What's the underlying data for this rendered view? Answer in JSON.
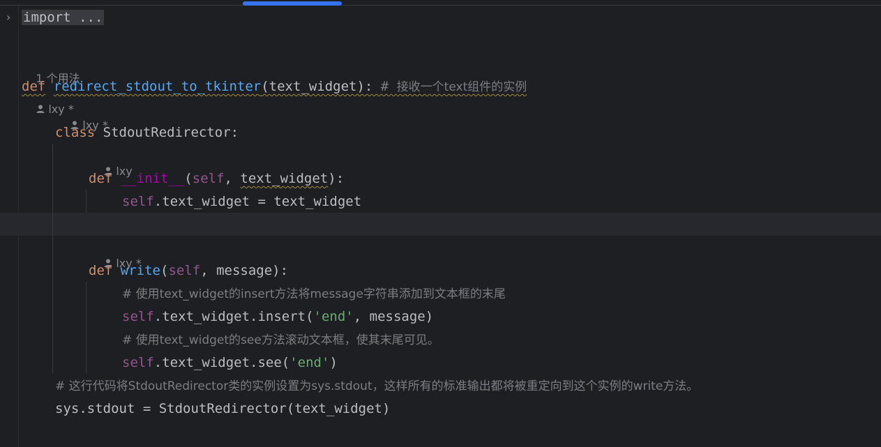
{
  "editor": {
    "fold_import": "import ...",
    "usages_hint": "1 个用法",
    "author_hints": {
      "def_author": "lxy *",
      "class_author": "lxy *",
      "init_author": "lxy",
      "write_author": "lxy *"
    },
    "code": {
      "def_kw": "def",
      "func_name": "redirect_stdout_to_tkinter",
      "func_params": "(text_widget):",
      "func_comment_hash": " # ",
      "func_comment": "接收一个text组件的实例",
      "class_kw": "class",
      "class_name": " StdoutRedirector:",
      "init_def_kw": "def",
      "init_name": "__init__",
      "init_open": "(",
      "init_self": "self",
      "init_sep": ", ",
      "init_param": "text_widget",
      "init_close": "):",
      "assign_self": "self",
      "assign_rest": ".text_widget = text_widget",
      "write_def_kw": "def",
      "write_name": "write",
      "write_open": "(",
      "write_self": "self",
      "write_rest": ", message):",
      "comment1": "# 使用text_widget的insert方法将message字符串添加到文本框的末尾",
      "insert_self": "self",
      "insert_call": ".text_widget.insert(",
      "insert_str": "'end'",
      "insert_rest": ", message)",
      "comment2": "# 使用text_widget的see方法滚动文本框，使其末尾可见。",
      "see_self": "self",
      "see_call": ".text_widget.see(",
      "see_str": "'end'",
      "see_rest": ")",
      "comment3": "# 这行代码将StdoutRedirector类的实例设置为sys.stdout，这样所有的标准输出都将被重定向到这个实例的write方法。",
      "sys_line": "sys.stdout = StdoutRedirector(text_widget)"
    }
  },
  "colors": {
    "background": "#1e1f22",
    "keyword": "#cf8e6d",
    "function": "#56a8f5",
    "magic": "#b200b2",
    "self": "#94558d",
    "string": "#6aab73",
    "comment": "#7a7e85",
    "text": "#bcbec4",
    "scroll_thumb": "#3574f0"
  }
}
